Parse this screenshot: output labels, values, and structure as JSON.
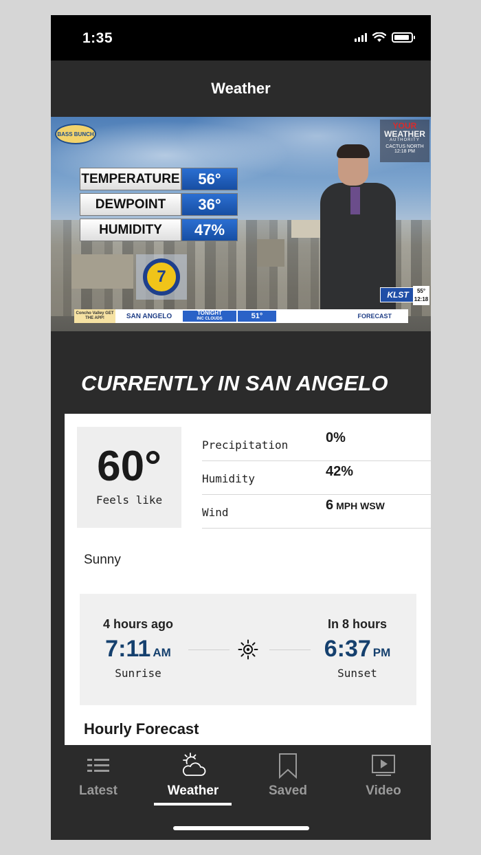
{
  "status_bar": {
    "time": "1:35"
  },
  "header": {
    "title": "Weather"
  },
  "video": {
    "sponsor": "BASS BUNCH",
    "brand": {
      "line1": "YOUR",
      "line2": "WEATHER",
      "line3": "AUTHORITY",
      "location": "CACTUS NORTH",
      "time": "12:18 PM"
    },
    "stats": [
      {
        "label": "TEMPERATURE",
        "value": "56°"
      },
      {
        "label": "DEWPOINT",
        "value": "36°"
      },
      {
        "label": "HUMIDITY",
        "value": "47%"
      }
    ],
    "channel_number": "7",
    "station": "KLST",
    "station_temp": "55°",
    "station_time": "12:18",
    "ticker": {
      "sponsor": "Concho Valley GET THE APP!",
      "city": "SAN ANGELO",
      "tonight": "TONIGHT",
      "tonight_sub": "INC CLOUDS",
      "temp": "51°",
      "forecast": "FORECAST"
    }
  },
  "current": {
    "title": "CURRENTLY IN SAN ANGELO",
    "temperature": "60°",
    "feels_like_label": "Feels like",
    "metrics": [
      {
        "label": "Precipitation",
        "value": "0%",
        "unit": ""
      },
      {
        "label": "Humidity",
        "value": "42%",
        "unit": ""
      },
      {
        "label": "Wind",
        "value": "6",
        "unit": "MPH WSW"
      }
    ],
    "condition": "Sunny",
    "sunrise": {
      "ago": "4 hours ago",
      "time": "7:11",
      "ampm": "AM",
      "label": "Sunrise"
    },
    "sunset": {
      "ago": "In 8 hours",
      "time": "6:37",
      "ampm": "PM",
      "label": "Sunset"
    },
    "hourly_title": "Hourly Forecast"
  },
  "tabs": [
    {
      "label": "Latest",
      "icon": "list-icon",
      "active": false
    },
    {
      "label": "Weather",
      "icon": "weather-icon",
      "active": true
    },
    {
      "label": "Saved",
      "icon": "bookmark-icon",
      "active": false
    },
    {
      "label": "Video",
      "icon": "video-icon",
      "active": false
    }
  ],
  "colors": {
    "accent_blue": "#15406e",
    "dark_bg": "#2b2b2b"
  }
}
